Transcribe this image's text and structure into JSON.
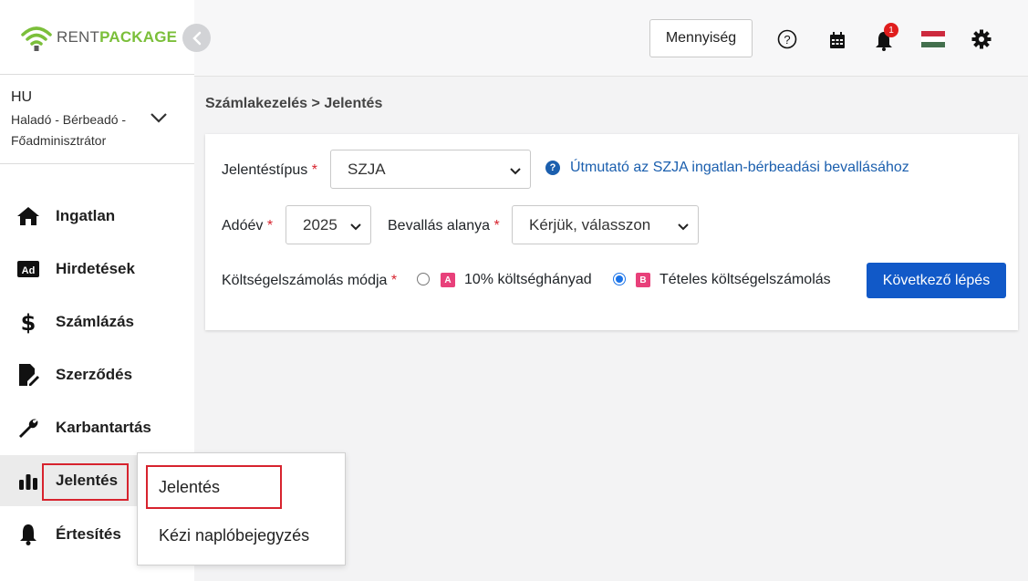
{
  "brand": {
    "logo_part1": "RENT",
    "logo_part2": "PACKAGE",
    "accent": "#7bbf3a"
  },
  "account": {
    "lang": "HU",
    "role": "Haladó - Bérbeadó - Főadminisztrátor"
  },
  "sidebar": {
    "items": [
      {
        "label": "Ingatlan",
        "icon": "home-icon"
      },
      {
        "label": "Hirdetések",
        "icon": "ad-icon"
      },
      {
        "label": "Számlázás",
        "icon": "dollar-icon"
      },
      {
        "label": "Szerződés",
        "icon": "contract-icon"
      },
      {
        "label": "Karbantartás",
        "icon": "wrench-icon"
      },
      {
        "label": "Jelentés",
        "icon": "bar-chart-icon"
      },
      {
        "label": "Értesítés",
        "icon": "bell-icon"
      }
    ]
  },
  "topbar": {
    "quantity_label": "Mennyiség",
    "notification_count": "1"
  },
  "breadcrumb": "Számlakezelés > Jelentés",
  "form": {
    "report_type_label": "Jelentéstípus",
    "report_type_value": "SZJA",
    "help_link": "Útmutató az SZJA ingatlan-bérbeadási bevallásához",
    "tax_year_label": "Adóév",
    "tax_year_value": "2025",
    "subject_label": "Bevallás alanya",
    "subject_value": "Kérjük, válasszon",
    "cost_method_label": "Költségelszámolás módja",
    "option_a_tag": "A",
    "option_a_label": "10% költséghányad",
    "option_b_tag": "B",
    "option_b_label": "Tételes költségelszámolás",
    "required_mark": "*",
    "next_button": "Következő lépés"
  },
  "submenu": {
    "items": [
      "Jelentés",
      "Kézi naplóbejegyzés"
    ]
  }
}
